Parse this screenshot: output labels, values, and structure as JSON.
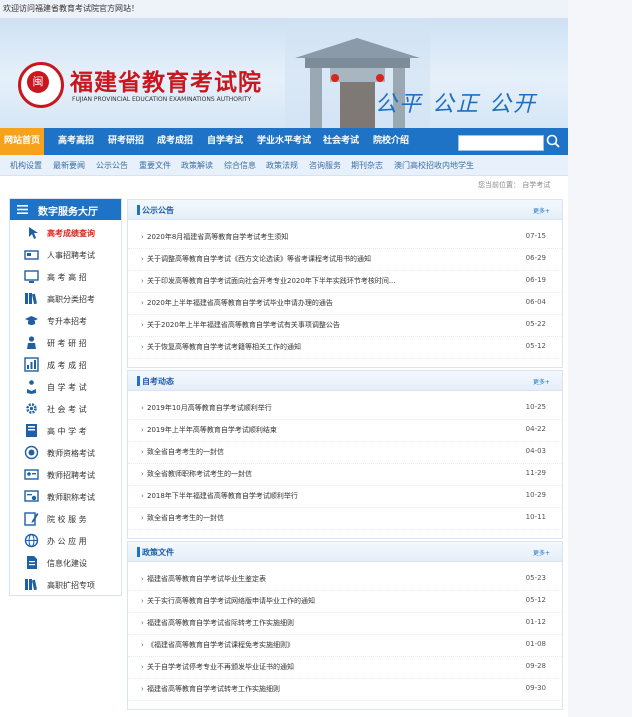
{
  "topbar": {
    "welcome": "欢迎访问福建省教育考试院官方网站！"
  },
  "header": {
    "seal_char": "闽",
    "site_name": "福建省教育考试院",
    "site_name_en": "FUJIAN PROVINCIAL EDUCATION EXAMINATIONS AUTHORITY",
    "motto": "公平 公正 公开"
  },
  "nav": {
    "items": [
      {
        "label": "网站首页",
        "active": true
      },
      {
        "label": "高考高招"
      },
      {
        "label": "研考研招"
      },
      {
        "label": "成考成招"
      },
      {
        "label": "自学考试"
      },
      {
        "label": "学业水平考试"
      },
      {
        "label": "社会考试"
      },
      {
        "label": "院校介绍"
      }
    ],
    "search": {
      "placeholder": "",
      "button_icon": "search-icon"
    }
  },
  "subnav": {
    "items": [
      "机构设置",
      "最新要闻",
      "公示公告",
      "重要文件",
      "政策解读",
      "综合信息",
      "政策法规",
      "咨询服务",
      "期刊杂志",
      "澳门高校招收内地学生"
    ]
  },
  "breadcrumb": {
    "prefix": "您当前位置：",
    "current": "自学考试"
  },
  "sidebar": {
    "title": "数字服务大厅",
    "items": [
      {
        "label": "高考成绩查询",
        "icon": "pointer-icon",
        "active": true
      },
      {
        "label": "人事招聘考试",
        "icon": "card-icon"
      },
      {
        "label": "高 考 高 招",
        "icon": "monitor-icon"
      },
      {
        "label": "高职分类招考",
        "icon": "books-icon"
      },
      {
        "label": "专升本招考",
        "icon": "graduation-cap-icon"
      },
      {
        "label": "研 考 研 招",
        "icon": "student-icon"
      },
      {
        "label": "成 考 成 招",
        "icon": "chart-icon"
      },
      {
        "label": "自 学 考 试",
        "icon": "person-reading-icon"
      },
      {
        "label": "社 会 考 试",
        "icon": "gear-icon"
      },
      {
        "label": "高 中 学 考",
        "icon": "book-icon"
      },
      {
        "label": "教师资格考试",
        "icon": "target-icon"
      },
      {
        "label": "教师招聘考试",
        "icon": "id-card-icon"
      },
      {
        "label": "教师职称考试",
        "icon": "certificate-icon"
      },
      {
        "label": "院 校 服 务",
        "icon": "edit-icon"
      },
      {
        "label": "办 公 应 用",
        "icon": "globe-icon"
      },
      {
        "label": "信息化建设",
        "icon": "document-icon"
      },
      {
        "label": "高职扩招专项",
        "icon": "books-icon"
      }
    ]
  },
  "panels": [
    {
      "title": "公示公告",
      "more": "更多+",
      "rows": [
        {
          "title": "2020年8月福建省高等教育自学考试考生须知",
          "date": "07-15"
        },
        {
          "title": "关于调整高等教育自学考试《西方文论选读》等省考课程考试用书的通知",
          "date": "06-29"
        },
        {
          "title": "关于印发高等教育自学考试面向社会开考专业2020年下半年实践环节考核时间...",
          "date": "06-19"
        },
        {
          "title": "2020年上半年福建省高等教育自学考试毕业申请办理的通告",
          "date": "06-04"
        },
        {
          "title": "关于2020年上半年福建省高等教育自学考试有关事项调整公告",
          "date": "05-22"
        },
        {
          "title": "关于恢复高等教育自学考试考籍等相关工作的通知",
          "date": "05-12"
        }
      ]
    },
    {
      "title": "自考动态",
      "more": "更多+",
      "rows": [
        {
          "title": "2019年10月高等教育自学考试顺利举行",
          "date": "10-25"
        },
        {
          "title": "2019年上半年高等教育自学考试顺利结束",
          "date": "04-22"
        },
        {
          "title": "致全省自考考生的一封信",
          "date": "04-03"
        },
        {
          "title": "致全省教师职称考试考生的一封信",
          "date": "11-29"
        },
        {
          "title": "2018年下半年福建省高等教育自学考试顺利举行",
          "date": "10-29"
        },
        {
          "title": "致全省自考考生的一封信",
          "date": "10-11"
        }
      ]
    },
    {
      "title": "政策文件",
      "more": "更多+",
      "rows": [
        {
          "title": "福建省高等教育自学考试毕业生鉴定表",
          "date": "05-23"
        },
        {
          "title": "关于实行高等教育自学考试网络版申请毕业工作的通知",
          "date": "05-12"
        },
        {
          "title": "福建省高等教育自学考试省际转考工作实施细则",
          "date": "01-12"
        },
        {
          "title": "《福建省高等教育自学考试课程免考实施细则》",
          "date": "01-08"
        },
        {
          "title": "关于自学考试停考专业不再颁发毕业证书的通知",
          "date": "09-28"
        },
        {
          "title": "福建省高等教育自学考试转考工作实施细则",
          "date": "09-30"
        }
      ]
    }
  ],
  "colors": {
    "brand_blue": "#1f73c7",
    "active_orange": "#f6a21c",
    "seal_red": "#c8171e"
  }
}
